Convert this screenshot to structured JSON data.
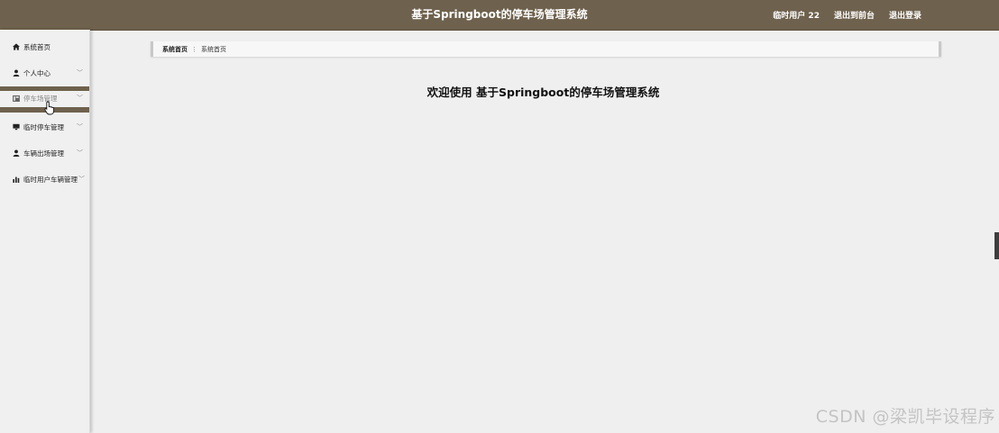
{
  "header": {
    "title": "基于Springboot的停车场管理系统",
    "user": "临时用户 22",
    "goto_front": "退出到前台",
    "logout": "退出登录"
  },
  "sidebar": {
    "items": [
      {
        "label": "系统首页",
        "icon": "home-icon",
        "has_submenu": false
      },
      {
        "label": "个人中心",
        "icon": "user-icon",
        "has_submenu": true
      },
      {
        "label": "停车场管理",
        "icon": "grid-icon",
        "has_submenu": true,
        "active": true
      },
      {
        "label": "临时停车管理",
        "icon": "monitor-icon",
        "has_submenu": true
      },
      {
        "label": "车辆出场管理",
        "icon": "user-icon",
        "has_submenu": true
      },
      {
        "label": "临时用户车辆管理",
        "icon": "bar-chart-icon",
        "has_submenu": true
      }
    ]
  },
  "breadcrumb": {
    "root": "系统首页",
    "separator": "⋮",
    "current": "系统首页"
  },
  "main": {
    "welcome": "欢迎使用 基于Springboot的停车场管理系统"
  },
  "watermark": "CSDN @梁凯毕设程序",
  "colors": {
    "header_bg": "#6e614d",
    "background": "#efefef"
  }
}
